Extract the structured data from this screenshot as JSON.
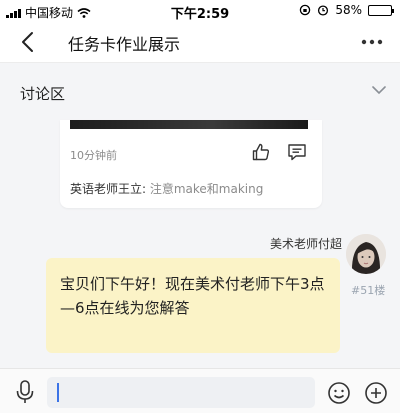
{
  "status_bar": {
    "carrier": "中国移动",
    "time": "下午2:59",
    "battery": "58%",
    "battery_level": 0.58,
    "icons": [
      "signal-icon",
      "wifi-icon",
      "alarm-icon",
      "orientation-lock-icon",
      "battery-icon"
    ]
  },
  "nav": {
    "title": "任务卡作业展示",
    "back_icon": "back-arrow-icon",
    "more_icon": "more-dots-icon"
  },
  "discussion": {
    "title": "讨论区",
    "toggle_icon": "chevron-down-icon"
  },
  "reply_card": {
    "time": "10分钟前",
    "comment_author": "英语老师王立:",
    "comment_text": " 注意make和making",
    "icons": [
      "like-icon",
      "comment-icon"
    ]
  },
  "message": {
    "sender": "美术老师付超",
    "floor": "#51楼",
    "text": "宝贝们下午好！现在美术付老师下午3点—6点在线为您解答"
  },
  "input_bar": {
    "value": "",
    "icons": [
      "mic-icon",
      "emoji-icon",
      "plus-icon"
    ]
  },
  "colors": {
    "bubble": "#fbf3c7",
    "background": "#f4f5f7",
    "caret": "#3b73e6"
  }
}
